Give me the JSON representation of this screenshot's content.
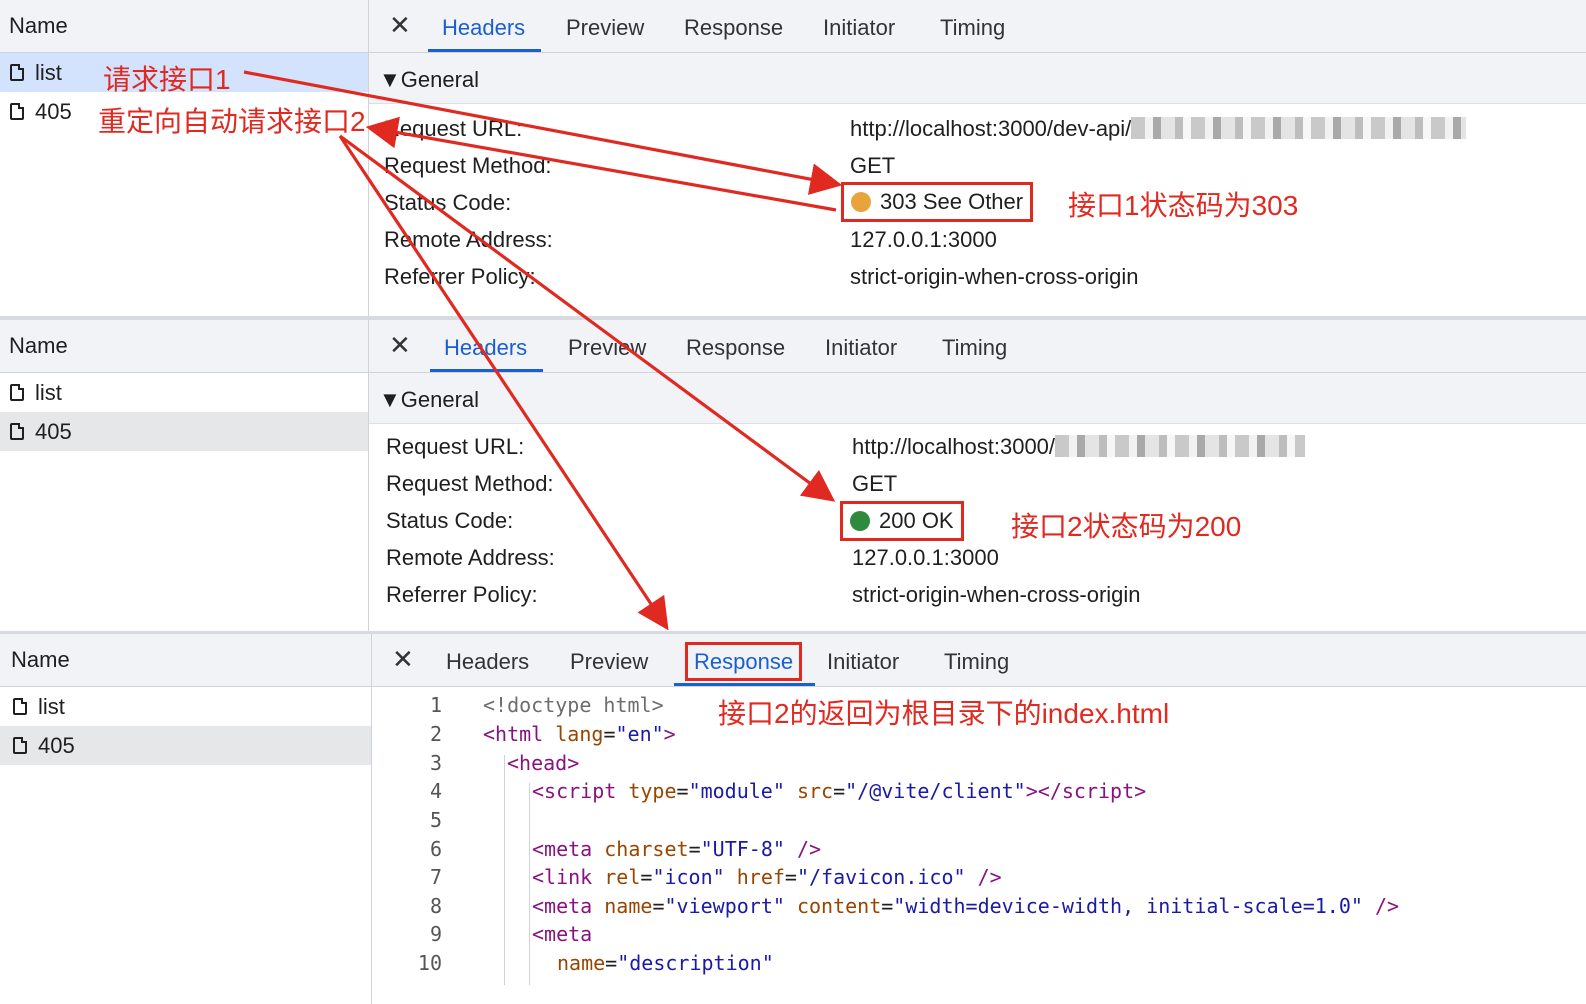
{
  "panels": [
    {
      "name_header": "Name",
      "requests": [
        "list",
        "405"
      ],
      "tabs": [
        "Headers",
        "Preview",
        "Response",
        "Initiator",
        "Timing"
      ],
      "active_tab": "Headers",
      "section": "General",
      "rows": [
        {
          "key": "Request URL:",
          "value": "http://localhost:3000/dev-api/"
        },
        {
          "key": "Request Method:",
          "value": "GET"
        },
        {
          "key": "Status Code:",
          "value": "303 See Other"
        },
        {
          "key": "Remote Address:",
          "value": "127.0.0.1:3000"
        },
        {
          "key": "Referrer Policy:",
          "value": "strict-origin-when-cross-origin"
        }
      ],
      "status_color": "#e8a33d"
    },
    {
      "name_header": "Name",
      "requests": [
        "list",
        "405"
      ],
      "tabs": [
        "Headers",
        "Preview",
        "Response",
        "Initiator",
        "Timing"
      ],
      "active_tab": "Headers",
      "section": "General",
      "rows": [
        {
          "key": "Request URL:",
          "value": "http://localhost:3000/"
        },
        {
          "key": "Request Method:",
          "value": "GET"
        },
        {
          "key": "Status Code:",
          "value": "200 OK"
        },
        {
          "key": "Remote Address:",
          "value": "127.0.0.1:3000"
        },
        {
          "key": "Referrer Policy:",
          "value": "strict-origin-when-cross-origin"
        }
      ],
      "status_color": "#2e8b3e"
    },
    {
      "name_header": "Name",
      "requests": [
        "list",
        "405"
      ],
      "tabs": [
        "Headers",
        "Preview",
        "Response",
        "Initiator",
        "Timing"
      ],
      "active_tab": "Response",
      "line_numbers": [
        "1",
        "2",
        "3",
        "4",
        "5",
        "6",
        "7",
        "8",
        "9",
        "10"
      ]
    }
  ],
  "annotations": {
    "request1": "请求接口1",
    "redirect2": "重定向自动请求接口2",
    "status303": "接口1状态码为303",
    "status200": "接口2状态码为200",
    "response": "接口2的返回为根目录下的index.html"
  },
  "colors": {
    "annotation": "#e02a21",
    "accent": "#1a5fd1"
  },
  "icons": {
    "close": "close-icon",
    "file": "file-icon",
    "status": "status-dot-icon"
  }
}
